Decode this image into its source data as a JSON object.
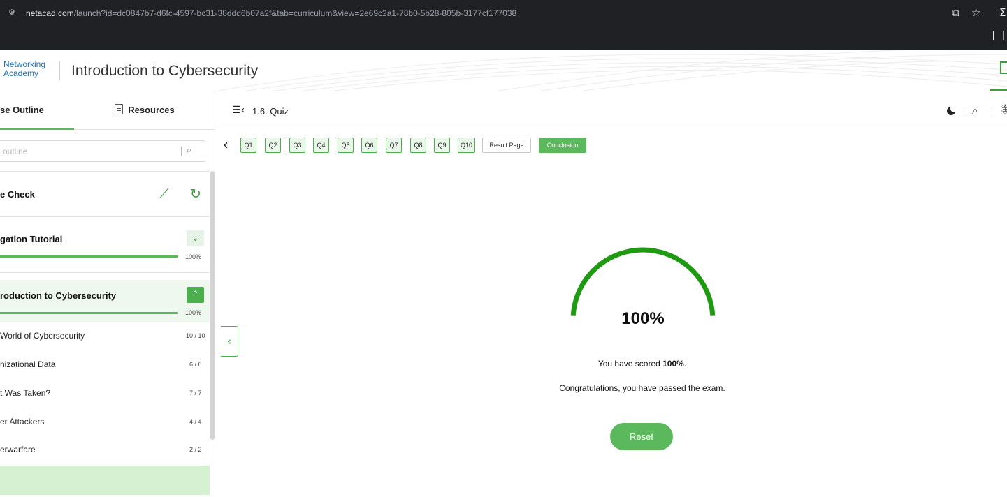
{
  "browser": {
    "site_icon": "site-settings-icon",
    "url_host": "netacad.com",
    "url_path": "/launch?id=dc0847b7-d6fc-4597-bc31-38ddd6b07a2f&tab=curriculum&view=2e69c2a1-78b0-5b28-805b-3177cf177038",
    "icons": [
      "install-app-icon",
      "bookmark-star-icon",
      "extensions-icon"
    ]
  },
  "header": {
    "brand_line1": "Networking",
    "brand_line2": "Academy",
    "course_title": "Introduction to Cybersecurity"
  },
  "sidebar": {
    "tabs": {
      "outline": "se Outline",
      "resources": "Resources"
    },
    "search_placeholder": "outline",
    "knowledge_check": {
      "title": "e Check"
    },
    "navigation_tutorial": {
      "title": "gation Tutorial",
      "progress": "100%",
      "progress_value": 1.0
    },
    "module": {
      "title": "roduction to Cybersecurity",
      "progress": "100%",
      "progress_value": 1.0
    },
    "lessons": [
      {
        "label": "World of Cybersecurity",
        "count": "10 / 10"
      },
      {
        "label": "nizational Data",
        "count": "6 / 6"
      },
      {
        "label": "t Was Taken?",
        "count": "7 / 7"
      },
      {
        "label": "er Attackers",
        "count": "4 / 4"
      },
      {
        "label": "erwarfare",
        "count": "2 / 2"
      }
    ]
  },
  "main": {
    "page_heading": "1.6. Quiz",
    "question_nav": [
      "Q1",
      "Q2",
      "Q3",
      "Q4",
      "Q5",
      "Q6",
      "Q7",
      "Q8",
      "Q9",
      "Q10"
    ],
    "result_page_label": "Result Page",
    "conclusion_label": "Conclusion",
    "score_value": 1.0,
    "score_text": "100%",
    "score_prefix": "You have scored ",
    "score_bold": "100%",
    "score_suffix": ".",
    "pass_message": "Congratulations, you have passed the exam.",
    "reset_label": "Reset"
  },
  "colors": {
    "accent": "#5cb85c",
    "gauge": "#1f9a12",
    "brand_blue": "#1a6fb8",
    "chrome_bg": "#202124"
  }
}
